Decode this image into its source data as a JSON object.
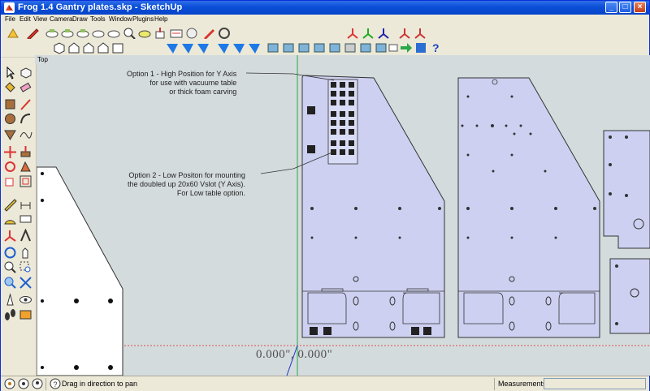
{
  "window": {
    "title": "Frog 1.4 Gantry plates.skp - SketchUp",
    "minimize": "_",
    "maximize": "□",
    "close": "×"
  },
  "menu": [
    "File",
    "Edit",
    "View",
    "Camera",
    "Draw",
    "Tools",
    "Window",
    "Plugins",
    "Help"
  ],
  "viewport": {
    "scene_label": "Top",
    "annotation_1": [
      "Option 1 - High Position for Y Axis",
      "for use with vacuume table",
      "or thick foam carving"
    ],
    "annotation_2": [
      "Option 2 - Low Positon for mounting",
      "the doubled up 20x60 Vslot (Y Axis).",
      "For Low table option."
    ],
    "measurement_readout": "0.000\", 0.000\""
  },
  "statusbar": {
    "hint": "Drag in direction to pan",
    "measurements_label": "Measurements",
    "measurements_value": ""
  },
  "colors": {
    "title_blue": "#0a4ed8",
    "plate_fill": "#cdd0f0",
    "viewport_bg": "#d4dbdd",
    "green_axis": "#2aa84a",
    "red_axis": "#d9534f"
  },
  "icons": {
    "toolbar_1": [
      "sketchup-logo-icon",
      "pencil-icon",
      "circle-icon",
      "circle-icon",
      "circle-icon",
      "circle-icon",
      "circle-icon",
      "circle-icon",
      "circle-icon",
      "circle-icon",
      "zoom-icon",
      "push-pull-icon",
      "push-pull-icon",
      "edit-icon",
      "walk-icon",
      "axes-icon",
      "axes-icon",
      "axes-icon",
      "axes-icon"
    ],
    "toolbar_2": [
      "iso-view-icon",
      "top-view-icon",
      "front-view-icon",
      "right-view-icon",
      "back-view-icon",
      "left-view-icon",
      "arrow-blue-icon",
      "arrow-blue-icon",
      "arrow-blue-icon",
      "arrow-blue-icon",
      "arrow-blue-icon",
      "arrow-blue-icon",
      "layers-icon",
      "layers-icon",
      "layers-icon",
      "layers-icon",
      "layers-icon",
      "layers-icon",
      "layers-icon",
      "layers-icon",
      "green-arrow-icon",
      "help-icon"
    ],
    "left_tools": [
      "select-icon",
      "eraser-icon",
      "paint-bucket-icon",
      "eraser-icon",
      "rectangle-icon",
      "line-icon",
      "circle-icon",
      "arc-icon",
      "polygon-icon",
      "freehand-icon",
      "move-icon",
      "push-pull-icon",
      "rotate-icon",
      "follow-me-icon",
      "scale-icon",
      "offset-icon",
      "tape-measure-icon",
      "dimension-icon",
      "protractor-icon",
      "text-icon",
      "axes-icon",
      "3d-text-icon",
      "orbit-icon",
      "pan-icon",
      "zoom-icon",
      "zoom-window-icon",
      "zoom-extents-icon",
      "previous-view-icon",
      "position-camera-icon",
      "look-around-icon",
      "walk-icon",
      "section-plane-icon"
    ]
  }
}
